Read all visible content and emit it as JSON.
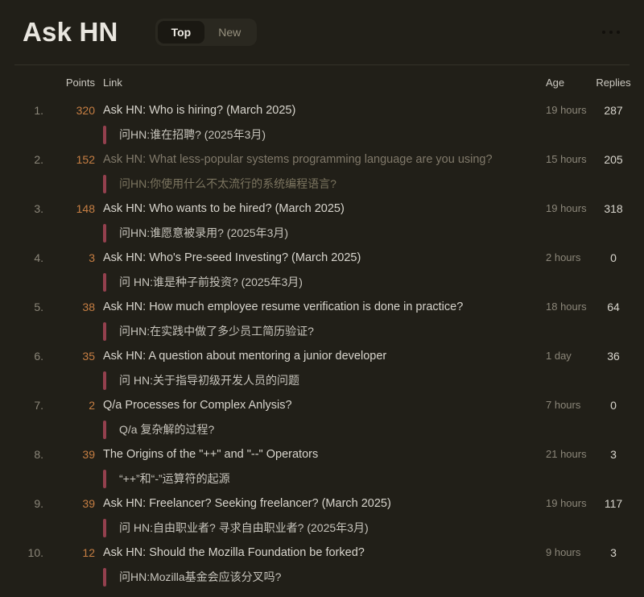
{
  "header": {
    "title": "Ask HN",
    "tabs": [
      {
        "label": "Top",
        "active": true
      },
      {
        "label": "New",
        "active": false
      }
    ],
    "menu_icon": "ellipsis-icon"
  },
  "table": {
    "columns": {
      "points": "Points",
      "link": "Link",
      "age": "Age",
      "replies": "Replies"
    }
  },
  "colors": {
    "background": "#211f18",
    "accent_points": "#c67e43",
    "accent_bar": "#94404e",
    "text_primary": "#d8d5cd",
    "text_muted": "#8b8679",
    "text_visited": "#80796a"
  },
  "items": [
    {
      "rank": "1.",
      "points": "320",
      "title": "Ask HN: Who is hiring? (March 2025)",
      "translation": "问HN:谁在招聘? (2025年3月)",
      "age": "19 hours",
      "replies": "287",
      "visited": false
    },
    {
      "rank": "2.",
      "points": "152",
      "title": "Ask HN: What less-popular systems programming language are you using?",
      "translation": "问HN:你使用什么不太流行的系统编程语言?",
      "age": "15 hours",
      "replies": "205",
      "visited": true
    },
    {
      "rank": "3.",
      "points": "148",
      "title": "Ask HN: Who wants to be hired? (March 2025)",
      "translation": "问HN:谁愿意被录用? (2025年3月)",
      "age": "19 hours",
      "replies": "318",
      "visited": false
    },
    {
      "rank": "4.",
      "points": "3",
      "title": "Ask HN: Who's Pre-seed Investing? (March 2025)",
      "translation": "问 HN:谁是种子前投资? (2025年3月)",
      "age": "2 hours",
      "replies": "0",
      "visited": false
    },
    {
      "rank": "5.",
      "points": "38",
      "title": "Ask HN: How much employee resume verification is done in practice?",
      "translation": "问HN:在实践中做了多少员工简历验证?",
      "age": "18 hours",
      "replies": "64",
      "visited": false
    },
    {
      "rank": "6.",
      "points": "35",
      "title": "Ask HN: A question about mentoring a junior developer",
      "translation": "问 HN:关于指导初级开发人员的问题",
      "age": "1 day",
      "replies": "36",
      "visited": false
    },
    {
      "rank": "7.",
      "points": "2",
      "title": "Q/a Processes for Complex Anlysis?",
      "translation": "Q/a 复杂解的过程?",
      "age": "7 hours",
      "replies": "0",
      "visited": false
    },
    {
      "rank": "8.",
      "points": "39",
      "title": "The Origins of the \"++\" and \"--\" Operators",
      "translation": "“++”和“-”运算符的起源",
      "age": "21 hours",
      "replies": "3",
      "visited": false
    },
    {
      "rank": "9.",
      "points": "39",
      "title": "Ask HN: Freelancer? Seeking freelancer? (March 2025)",
      "translation": "问 HN:自由职业者? 寻求自由职业者? (2025年3月)",
      "age": "19 hours",
      "replies": "117",
      "visited": false
    },
    {
      "rank": "10.",
      "points": "12",
      "title": "Ask HN: Should the Mozilla Foundation be forked?",
      "translation": "问HN:Mozilla基金会应该分叉吗?",
      "age": "9 hours",
      "replies": "3",
      "visited": false
    }
  ]
}
